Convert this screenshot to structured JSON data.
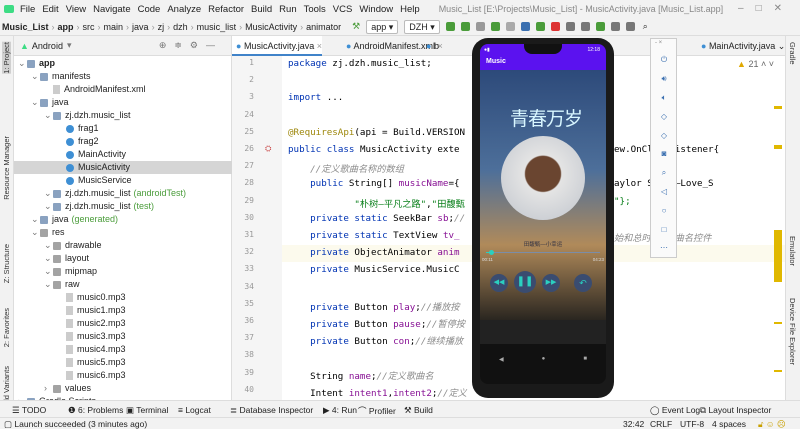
{
  "menu": {
    "items": [
      "File",
      "Edit",
      "View",
      "Navigate",
      "Code",
      "Analyze",
      "Refactor",
      "Build",
      "Run",
      "Tools",
      "VCS",
      "Window",
      "Help"
    ],
    "title": "Music_List [E:\\Projects\\Music_List] - MusicActivity.java [Music_List.app]"
  },
  "breadcrumb": [
    "Music_List",
    "app",
    "src",
    "main",
    "java",
    "zj",
    "dzh",
    "music_list",
    "MusicActivity",
    "animator"
  ],
  "toolbar": {
    "run_config": "app",
    "device": "DZH"
  },
  "left_stripe": [
    "1: Project",
    "Resource Manager",
    "Z: Structure",
    "2: Favorites",
    "Build Variants"
  ],
  "right_stripe": [
    "Gradle",
    "Emulator",
    "Device File Explorer"
  ],
  "project": {
    "view": "Android",
    "tree": [
      {
        "label": "app",
        "depth": 0,
        "type": "module"
      },
      {
        "label": "manifests",
        "depth": 1,
        "type": "folder"
      },
      {
        "label": "AndroidManifest.xml",
        "depth": 2,
        "type": "file"
      },
      {
        "label": "java",
        "depth": 1,
        "type": "folder"
      },
      {
        "label": "zj.dzh.music_list",
        "depth": 2,
        "type": "folder"
      },
      {
        "label": "frag1",
        "depth": 3,
        "type": "class"
      },
      {
        "label": "frag2",
        "depth": 3,
        "type": "class"
      },
      {
        "label": "MainActivity",
        "depth": 3,
        "type": "class"
      },
      {
        "label": "MusicActivity",
        "depth": 3,
        "type": "class",
        "selected": true
      },
      {
        "label": "MusicService",
        "depth": 3,
        "type": "class"
      },
      {
        "label": "zj.dzh.music_list",
        "suffix": "(androidTest)",
        "depth": 2,
        "type": "folder"
      },
      {
        "label": "zj.dzh.music_list",
        "suffix": "(test)",
        "depth": 2,
        "type": "folder"
      },
      {
        "label": "java",
        "suffix": "(generated)",
        "depth": 1,
        "type": "folder"
      },
      {
        "label": "res",
        "depth": 1,
        "type": "res"
      },
      {
        "label": "drawable",
        "depth": 2,
        "type": "res"
      },
      {
        "label": "layout",
        "depth": 2,
        "type": "res"
      },
      {
        "label": "mipmap",
        "depth": 2,
        "type": "res"
      },
      {
        "label": "raw",
        "depth": 2,
        "type": "res"
      },
      {
        "label": "music0.mp3",
        "depth": 3,
        "type": "file"
      },
      {
        "label": "music1.mp3",
        "depth": 3,
        "type": "file"
      },
      {
        "label": "music2.mp3",
        "depth": 3,
        "type": "file"
      },
      {
        "label": "music3.mp3",
        "depth": 3,
        "type": "file"
      },
      {
        "label": "music4.mp3",
        "depth": 3,
        "type": "file"
      },
      {
        "label": "music5.mp3",
        "depth": 3,
        "type": "file"
      },
      {
        "label": "music6.mp3",
        "depth": 3,
        "type": "file"
      },
      {
        "label": "values",
        "depth": 2,
        "type": "res"
      },
      {
        "label": "Gradle Scripts",
        "depth": 0,
        "type": "folder"
      }
    ]
  },
  "tabs": [
    {
      "label": "MusicActivity.java",
      "active": true
    },
    {
      "label": "AndroidManifest.xml"
    },
    {
      "label": "b"
    },
    {
      "label": "MainActivity.java"
    }
  ],
  "editor": {
    "warnings": "21",
    "lines": [
      {
        "n": "1",
        "left": "package zj.dzh.music_list;",
        "right": ""
      },
      {
        "n": "2",
        "left": "",
        "right": ""
      },
      {
        "n": "3",
        "left": "import ...",
        "right": ""
      },
      {
        "n": "24",
        "left": "",
        "right": ""
      },
      {
        "n": "25",
        "left": "@RequiresApi(api = Build.VERSION",
        "right": ""
      },
      {
        "n": "26",
        "left": "public class MusicActivity exte",
        "right": "ew.OnClickListener{"
      },
      {
        "n": "27",
        "left": "    //定义歌曲名称的数组",
        "right": ""
      },
      {
        "n": "28",
        "left": "    public String[] musicName={",
        "right": "aylor Swift—Love_S"
      },
      {
        "n": "29",
        "left": "            \"朴树—平凡之路\",\"田馥甄",
        "right": "\"};"
      },
      {
        "n": "30",
        "left": "    private static SeekBar sb;//",
        "right": ""
      },
      {
        "n": "31",
        "left": "    private static TextView tv_",
        "right": "始和总时长,歌曲名控件"
      },
      {
        "n": "32",
        "left": "    private ObjectAnimator anim",
        "right": ""
      },
      {
        "n": "33",
        "left": "    private MusicService.MusicC",
        "right": ""
      },
      {
        "n": "34",
        "left": "",
        "right": ""
      },
      {
        "n": "35",
        "left": "    private Button play;//播放按",
        "right": ""
      },
      {
        "n": "36",
        "left": "    private Button pause;//暂停按",
        "right": ""
      },
      {
        "n": "37",
        "left": "    private Button con;//继续播放",
        "right": ""
      },
      {
        "n": "38",
        "left": "",
        "right": ""
      },
      {
        "n": "39",
        "left": "    String name;//定义歌曲名",
        "right": ""
      },
      {
        "n": "40",
        "left": "    Intent intent1,intent2;//定义",
        "right": ""
      }
    ]
  },
  "phone": {
    "app_title": "Music",
    "time": "12:18",
    "song": "田馥甄—小幸运",
    "elapsed": "00:11",
    "total": "04:23",
    "progress": 0.04,
    "album_text": "青春万岁"
  },
  "bottom_tools": [
    "TODO",
    "6: Problems",
    "Terminal",
    "Logcat",
    "Database Inspector",
    "4: Run",
    "Profiler",
    "Build"
  ],
  "bottom_right_tools": [
    "Event Log",
    "Layout Inspector"
  ],
  "status": {
    "message": "Launch succeeded (3 minutes ago)",
    "position": "32:42",
    "line_sep": "CRLF",
    "encoding": "UTF-8",
    "indent": "4 spaces"
  },
  "colors": {
    "accent": "#5b12ef",
    "seek": "#2bd0c0",
    "button": "#3a4c70"
  }
}
